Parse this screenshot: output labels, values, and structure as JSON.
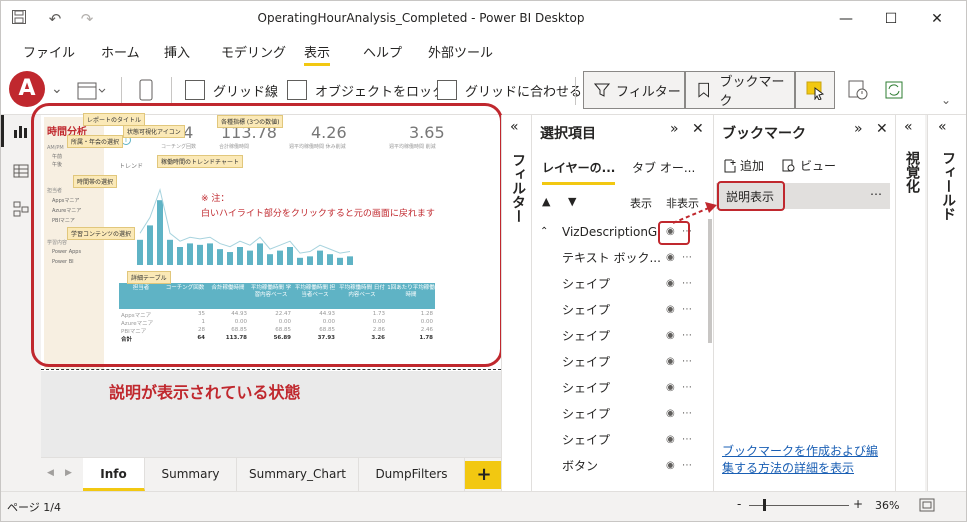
{
  "app": {
    "title": "OperatingHourAnalysis_Completed - Power BI Desktop",
    "win_minimize": "—",
    "win_restore": "☐",
    "win_close": "✕"
  },
  "menu": [
    "ファイル",
    "ホーム",
    "挿入",
    "モデリング",
    "表示",
    "ヘルプ",
    "外部ツール"
  ],
  "menu_active_index": 4,
  "ribbon": {
    "gridlines": "グリッド線",
    "lock_objects": "オブジェクトをロック",
    "snap_to_grid": "グリッドに合わせる",
    "filter": "フィルター",
    "bookmark": "ブックマーク"
  },
  "annotation_letter": "A",
  "annotation_caption": "説明が表示されている状態",
  "report": {
    "title": "時間分析",
    "kpi_values": [
      "64",
      "113.78",
      "4.26",
      "3.65"
    ],
    "kpi_labels": [
      "コーチング回数",
      "合計稼働時間",
      "週平均稼働時間 休み削減",
      "週平均稼働時間 削減"
    ],
    "trend_label": "トレンド",
    "slicer_label1": "AM/PM",
    "slicer_label2": "担当者",
    "slicer_label3": "学習内容",
    "slicer_items1": [
      "午前",
      "午後"
    ],
    "slicer_items2": [
      "Appsマニア",
      "Azureマニア",
      "PBIマニア"
    ],
    "slicer_items3": [
      "Power Apps",
      "Power BI"
    ],
    "note_line1": "※ 注：",
    "note_line2": "白いハイライト部分をクリックすると元の画面に戻れます",
    "table_headers": [
      "担当者",
      "コーチング回数",
      "合計稼働時間",
      "平均稼働時間 学習内容ベース",
      "平均稼働時間 担当者ベース",
      "平均稼働時間 日付内容ベース",
      "1回あたり平均稼働時間"
    ],
    "table_rows": [
      [
        "Appsマニア",
        "35",
        "44.93",
        "22.47",
        "44.93",
        "1.73",
        "1.28"
      ],
      [
        "Azureマニア",
        "1",
        "0.00",
        "0.00",
        "0.00",
        "0.00",
        "0.00"
      ],
      [
        "PBIマニア",
        "28",
        "68.85",
        "68.85",
        "68.85",
        "2.86",
        "2.46"
      ],
      [
        "合計",
        "64",
        "113.78",
        "56.89",
        "37.93",
        "3.26",
        "1.78"
      ]
    ],
    "tooltips": [
      "レポートのタイトル",
      "状態可視化アイコン",
      "各種指標 (3つの数値)",
      "時間帯の選択",
      "所属・年会の選択",
      "学習コンテンツの選択",
      "稼働時間のトレンドチャート",
      "詳細テーブル"
    ],
    "chart_bar_values": [
      0.35,
      0.55,
      0.9,
      0.35,
      0.25,
      0.3,
      0.28,
      0.3,
      0.22,
      0.18,
      0.25,
      0.2,
      0.3,
      0.15,
      0.2,
      0.25,
      0.1,
      0.12,
      0.2,
      0.15,
      0.1,
      0.12
    ]
  },
  "tabs": [
    "Info",
    "Summary",
    "Summary_Chart",
    "DumpFilters"
  ],
  "tab_add": "+",
  "status": {
    "page": "ページ 1/4",
    "zoom": "36%"
  },
  "filter_pane": {
    "title": "フィルター"
  },
  "selection_pane": {
    "title": "選択項目",
    "tab_layers": "レイヤーの...",
    "tab_order": "タブ オー...",
    "show": "表示",
    "hide": "非表示",
    "items": [
      "VizDescriptionG",
      "テキスト ボック...",
      "シェイプ",
      "シェイプ",
      "シェイプ",
      "シェイプ",
      "シェイプ",
      "シェイプ",
      "シェイプ",
      "ボタン"
    ]
  },
  "bookmark_pane": {
    "title": "ブックマーク",
    "add": "追加",
    "view": "ビュー",
    "item": "説明表示",
    "help": "ブックマークを作成および編集する方法の詳細を表示"
  },
  "viz_pane": {
    "title": "視覚化"
  },
  "fields_pane": {
    "title": "フィールド"
  },
  "colors": {
    "accent": "#f2c811",
    "annotation_red": "#c0282e",
    "teal": "#5fb3c5"
  }
}
